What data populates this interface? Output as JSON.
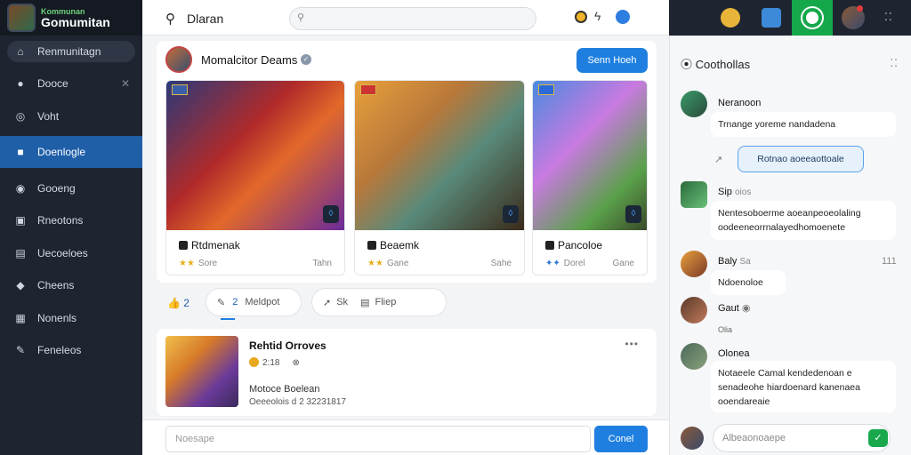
{
  "sidebar": {
    "brand_top": "Kommunan",
    "brand_name": "Gomumitan",
    "items": [
      {
        "label": "Renmunitagn",
        "icon": "home-icon"
      },
      {
        "label": "Dooce",
        "icon": "user-icon"
      },
      {
        "label": "Voht",
        "icon": "chat-icon"
      },
      {
        "label": "Doenlogle",
        "icon": "store-icon"
      },
      {
        "label": "Gooeng",
        "icon": "globe-icon"
      },
      {
        "label": "Rneotons",
        "icon": "gamepad-icon"
      },
      {
        "label": "Uecoeloes",
        "icon": "list-icon"
      },
      {
        "label": "Cheens",
        "icon": "tag-icon"
      },
      {
        "label": "Nonenls",
        "icon": "calendar-icon"
      },
      {
        "label": "Feneleos",
        "icon": "settings-icon"
      }
    ],
    "active_index": 3
  },
  "header": {
    "title": "Dlaran",
    "search_placeholder": ""
  },
  "feed": {
    "post": {
      "title": "Momalcitor Deams",
      "button": "Senn Hoeh",
      "tiles": [
        {
          "name": "Rtdmenak",
          "meta": "Sore",
          "right": "Tahn"
        },
        {
          "name": "Beaemk",
          "meta": "Gane",
          "right": "Sahe"
        },
        {
          "name": "Pancoloe",
          "meta": "Dorel",
          "right": "Gane"
        }
      ]
    },
    "actions": {
      "likes": "2",
      "reply_count": "2",
      "reply_label": "Meldpot",
      "share_label": "Sk",
      "filter_label": "Fliep"
    },
    "post2": {
      "title": "Rehtid Orroves",
      "stat": "2:18",
      "line1": "Motoce Boelean",
      "line2": "Oeeeolois d 2 32231817"
    },
    "composer": {
      "placeholder": "Noesape",
      "button": "Conel"
    }
  },
  "chat": {
    "title": "Coothollas",
    "messages": [
      {
        "name": "Neranoon",
        "text": "Trnange yoreme nandadena"
      },
      {
        "sent": "Rotnao aoeeaottoale"
      },
      {
        "name": "Sip",
        "meta": "oios",
        "text": "Nentesoboerme aoeanpeoeolaling oodeeneorrnalayedhomoenete"
      },
      {
        "name": "Baly",
        "meta": "Sa",
        "right": "111",
        "text": "Ndoenoloe"
      },
      {
        "name": "Gaut",
        "extra": "Olia"
      },
      {
        "name": "Olonea",
        "text": "Notaeele Camal kendedenoan e senadeohe hiardoenard kanenaea ooendareaie"
      }
    ],
    "input_placeholder": "Albeaonoaepe"
  }
}
